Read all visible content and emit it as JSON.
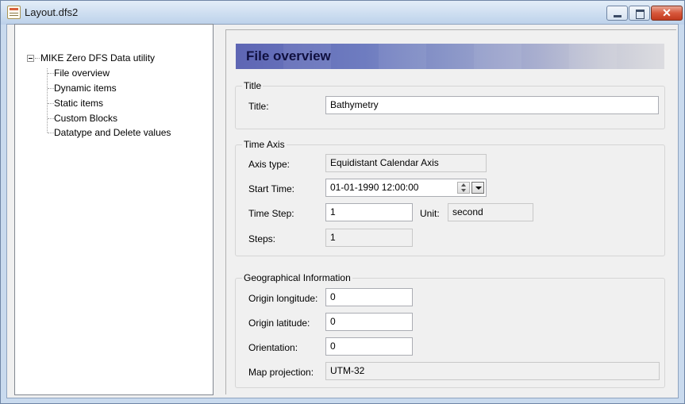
{
  "window": {
    "title": "Layout.dfs2",
    "close_glyph": "✕",
    "icons": {
      "app": "document-icon",
      "minimize": "minimize-icon",
      "maximize": "maximize-icon",
      "close": "close-icon"
    }
  },
  "tree": {
    "root_label": "MIKE Zero DFS Data utility",
    "items": [
      {
        "label": "File overview",
        "selected": true
      },
      {
        "label": "Dynamic items"
      },
      {
        "label": "Static items"
      },
      {
        "label": "Custom Blocks"
      },
      {
        "label": "Datatype and Delete values"
      }
    ]
  },
  "header": {
    "title": "File overview"
  },
  "title_group": {
    "legend": "Title",
    "title_label": "Title:",
    "title_value": "Bathymetry"
  },
  "time_axis": {
    "legend": "Time Axis",
    "axis_type_label": "Axis type:",
    "axis_type_value": "Equidistant Calendar Axis",
    "start_time_label": "Start Time:",
    "start_time_value": "01-01-1990 12:00:00",
    "time_step_label": "Time Step:",
    "time_step_value": "1",
    "unit_label": "Unit:",
    "unit_value": "second",
    "steps_label": "Steps:",
    "steps_value": "1"
  },
  "geo": {
    "legend": "Geographical Information",
    "origin_longitude_label": "Origin longitude:",
    "origin_longitude_value": "0",
    "origin_latitude_label": "Origin latitude:",
    "origin_latitude_value": "0",
    "orientation_label": "Orientation:",
    "orientation_value": "0",
    "map_projection_label": "Map projection:",
    "map_projection_value": "UTM-32"
  },
  "colors": {
    "header_gradient_start": "#5e66b4",
    "selection": "#ffffff"
  }
}
